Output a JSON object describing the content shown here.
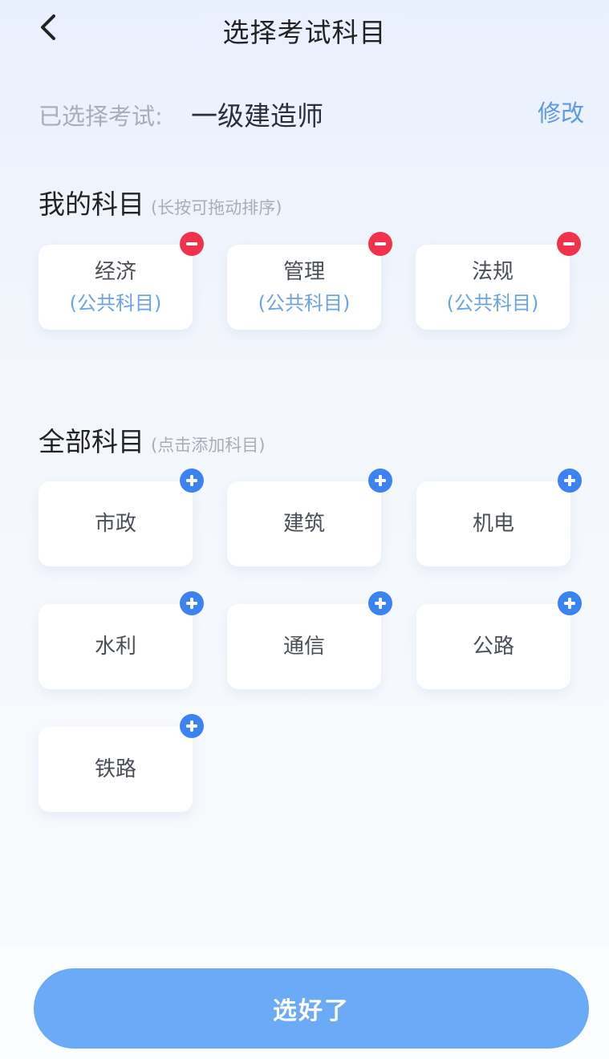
{
  "header": {
    "title": "选择考试科目",
    "back_icon": "chevron-left-icon"
  },
  "exam": {
    "label": "已选择考试:",
    "value": "一级建造师",
    "modify": "修改"
  },
  "my_subjects": {
    "title": "我的科目",
    "hint": "(长按可拖动排序)",
    "items": [
      {
        "name": "经济",
        "sub": "(公共科目)"
      },
      {
        "name": "管理",
        "sub": "(公共科目)"
      },
      {
        "name": "法规",
        "sub": "(公共科目)"
      }
    ]
  },
  "all_subjects": {
    "title": "全部科目",
    "hint": "(点击添加科目)",
    "items": [
      {
        "name": "市政"
      },
      {
        "name": "建筑"
      },
      {
        "name": "机电"
      },
      {
        "name": "水利"
      },
      {
        "name": "通信"
      },
      {
        "name": "公路"
      },
      {
        "name": "铁路"
      }
    ]
  },
  "done_button": "选好了",
  "colors": {
    "accent": "#3b82f2",
    "remove": "#f0334a",
    "button": "#6aaaf7",
    "link": "#5a9ae8"
  }
}
